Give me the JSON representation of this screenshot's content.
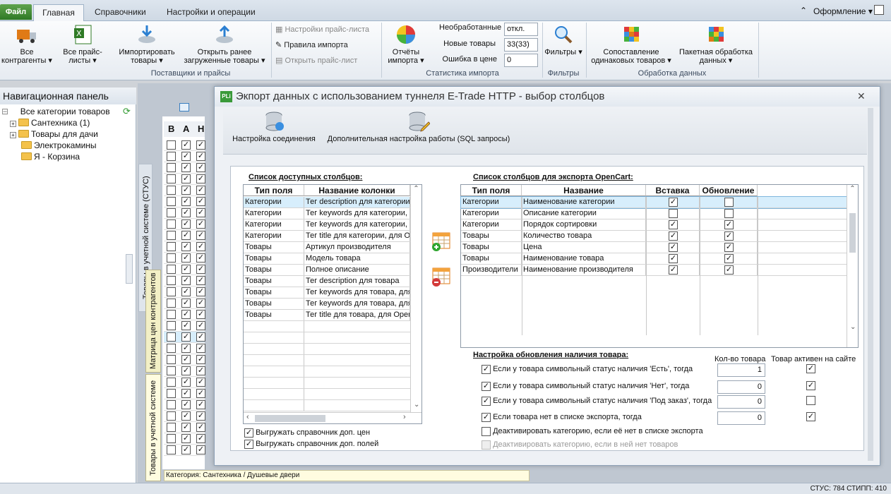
{
  "ribbon_tabs": {
    "file": "Файл",
    "home": "Главная",
    "refs": "Справочники",
    "settings": "Настройки и операции",
    "appearance": "Оформление"
  },
  "groups": {
    "suppliers": {
      "label": "Поставщики и прайсы",
      "all_contractors": "Все контрагенты",
      "all_pricelists": "Все прайс-листы",
      "import_goods": "Импортировать товары",
      "open_loaded": "Открыть ранее загруженные товары"
    },
    "pricelist": {
      "settings": "Настройки прайс-листа",
      "rules": "Правила импорта",
      "open": "Открыть прайс-лист"
    },
    "stats": {
      "label": "Статистика импорта",
      "reports": "Отчёты импорта",
      "unprocessed_lbl": "Необработанные",
      "unprocessed_val": "откл.",
      "new_lbl": "Новые товары",
      "new_val": "33(33)",
      "err_lbl": "Ошибка в цене",
      "err_val": "0"
    },
    "filters": {
      "label": "Фильтры",
      "btn": "Фильтры"
    },
    "processing": {
      "label": "Обработка данных",
      "compare": "Сопоставление одинаковых товаров",
      "batch": "Пакетная обработка данных"
    }
  },
  "nav": {
    "title": "Навигационная панель",
    "items": [
      "Все категории товаров",
      "Сантехника (1)",
      "Товары для дачи",
      "Электрокамины",
      "Я - Корзина"
    ]
  },
  "side_tabs": {
    "status": "Товары в учетной системе (СТУС)",
    "matrix": "Матрица цен контрагентов",
    "goods": "Товары в учетной системе"
  },
  "bg_grid": {
    "cols": [
      "В",
      "А",
      "Н"
    ],
    "footer": "Категория: Сантехника / Душевые двери"
  },
  "dialog": {
    "title": "Экпорт данных с использованием туннеля E-Trade HTTP - выбор столбцов",
    "toolbar": {
      "conn": "Настройка соединения",
      "sql": "Дополнительная настройка работы (SQL запросы)"
    },
    "left": {
      "title": "Список доступных столбцов:",
      "headers": [
        "Тип поля",
        "Название колонки"
      ],
      "rows": [
        [
          "Категории",
          "Тег description для категории"
        ],
        [
          "Категории",
          "Тег keywords для категории, для"
        ],
        [
          "Категории",
          "Тег keywords для категории, для"
        ],
        [
          "Категории",
          "Тег title для категории, для Oper"
        ],
        [
          "Товары",
          "Артикул производителя"
        ],
        [
          "Товары",
          "Модель товара"
        ],
        [
          "Товары",
          "Полное описание"
        ],
        [
          "Товары",
          "Тег description для товара"
        ],
        [
          "Товары",
          "Тег keywords для товара, для Op"
        ],
        [
          "Товары",
          "Тег keywords для товара, для Op"
        ],
        [
          "Товары",
          "Тег title для товара, для OpenCa"
        ]
      ],
      "opt1": "Выгружать справочник доп. цен",
      "opt2": "Выгружать справочник доп. полей"
    },
    "right": {
      "title": "Список столбцов для экспорта OpenCart:",
      "headers": [
        "Тип поля",
        "Название",
        "Вставка",
        "Обновление"
      ],
      "rows": [
        [
          "Категории",
          "Наименование категории",
          true,
          false
        ],
        [
          "Категории",
          "Описание категории",
          false,
          false
        ],
        [
          "Категории",
          "Порядок сортировки",
          true,
          true
        ],
        [
          "Товары",
          "Количество товара",
          true,
          true
        ],
        [
          "Товары",
          "Цена",
          true,
          true
        ],
        [
          "Товары",
          "Наименование товара",
          true,
          true
        ],
        [
          "Производители",
          "Наименование производителя",
          true,
          true
        ]
      ]
    },
    "avail": {
      "title": "Настройка обновления наличия товара:",
      "col_qty": "Кол-во товара",
      "col_active": "Товар активен на сайте",
      "rows": [
        {
          "text": "Если у товара символьный статус наличия 'Есть', тогда",
          "qty": "1",
          "active": true
        },
        {
          "text": "Если у товара символьный статус наличия 'Нет', тогда",
          "qty": "0",
          "active": true
        },
        {
          "text": "Если у товара символьный статус наличия 'Под заказ', тогда",
          "qty": "0",
          "active": false
        },
        {
          "text": "Если товара нет в списке экспорта, тогда",
          "qty": "0",
          "active": true
        }
      ],
      "deact1": "Деактивировать категорию, если её нет в списке экспорта",
      "deact2": "Деактивировать категорию, если в ней нет товаров"
    }
  },
  "statusbar": {
    "text": "СТУС: 784    СТИПП: 410"
  }
}
